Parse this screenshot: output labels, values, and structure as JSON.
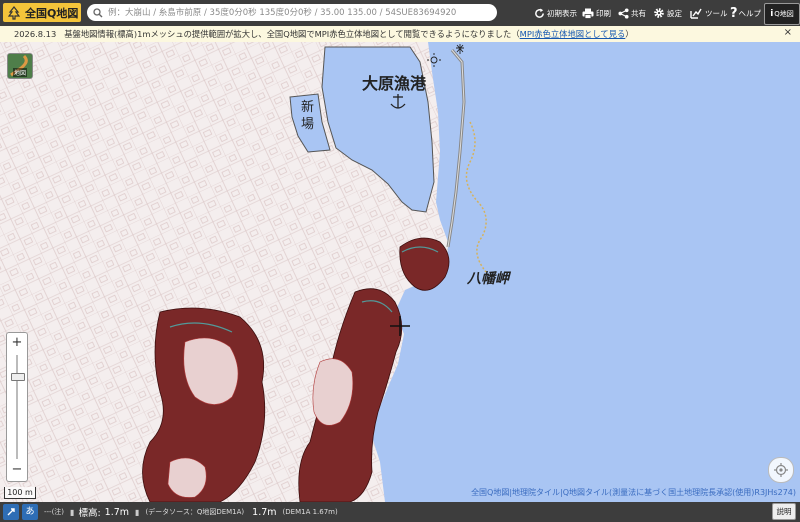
{
  "app": {
    "title": "全国Q地図",
    "icon": "tree-icon"
  },
  "search": {
    "placeholder": "例：大崩山 / 糸島市前原 / 35度0分0秒 135度0分0秒 / 35.00 135.00 / 54SUE83694920",
    "value": ""
  },
  "toolbar": {
    "initial_label": "初期表示",
    "print_label": "印刷",
    "share_label": "共有",
    "settings_label": "設定",
    "tools_label": "ツール",
    "help_label": "ヘルプ",
    "qchizu_label": "Q地図"
  },
  "notice": {
    "date": "2026.8.13",
    "text": "基盤地図情報(標高)1mメッシュの提供範囲が拡大し、全国Q地図でMPI赤色立体地図として閲覧できるようになりました（",
    "link": "MPI赤色立体地図として見る",
    "end": "）",
    "close": "×"
  },
  "map": {
    "places": {
      "port": "大原漁港",
      "shinba": "新場",
      "cape": "八幡岬"
    },
    "layer_button_label": "地図",
    "scale_label": "100 m",
    "zoom_in": "+",
    "zoom_out": "−",
    "zoom_level": 0.2,
    "attribution": "全国Q地図|地理院タイル|Q地図タイル(測量法に基づく国土地理院長承認(使用)R3JHs274)",
    "colors": {
      "sea": "#a9c5f3",
      "land": "#f4eeee",
      "relief": "#b03a3a",
      "cyan": "#49b6b6"
    }
  },
  "status": {
    "ime_label": "あ",
    "coord_text": "---(注)",
    "elev_label": "標高:",
    "elev_value": "1.7m",
    "source_text": "(データソース：Q地図DEM1A)",
    "elev_value2": "1.7m",
    "source_text2": "(DEM1A 1.67m)",
    "explain_label": "説明"
  }
}
